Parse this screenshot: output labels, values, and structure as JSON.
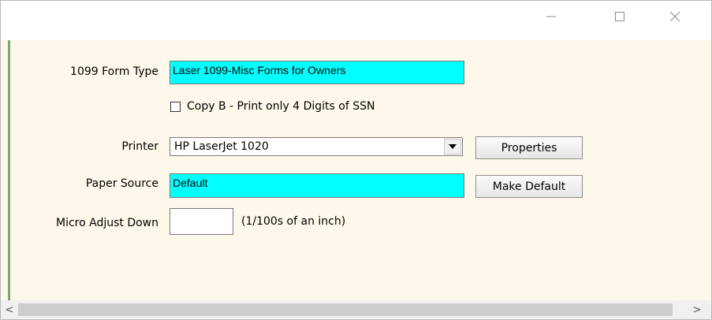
{
  "window": {
    "controls": {
      "minimize_icon": "minimize-icon",
      "maximize_icon": "maximize-icon",
      "close_icon": "close-icon"
    }
  },
  "form": {
    "form_type": {
      "label": "1099 Form Type",
      "value": "Laser 1099-Misc Forms for Owners"
    },
    "copy_b": {
      "label": "Copy B - Print only 4 Digits of SSN",
      "checked": false
    },
    "printer": {
      "label": "Printer",
      "value": "HP LaserJet 1020"
    },
    "properties_button": "Properties",
    "paper_source": {
      "label": "Paper Source",
      "value": "Default"
    },
    "make_default_button": "Make Default",
    "micro_adjust": {
      "label": "Micro Adjust Down",
      "value": "",
      "unit": "(1/100s of an inch)"
    }
  },
  "scrollbar": {
    "left_arrow": "<",
    "right_arrow": ">"
  },
  "colors": {
    "field_highlight": "#00ffff",
    "form_background": "#fdf8ea",
    "left_accent": "#7ea67a"
  }
}
